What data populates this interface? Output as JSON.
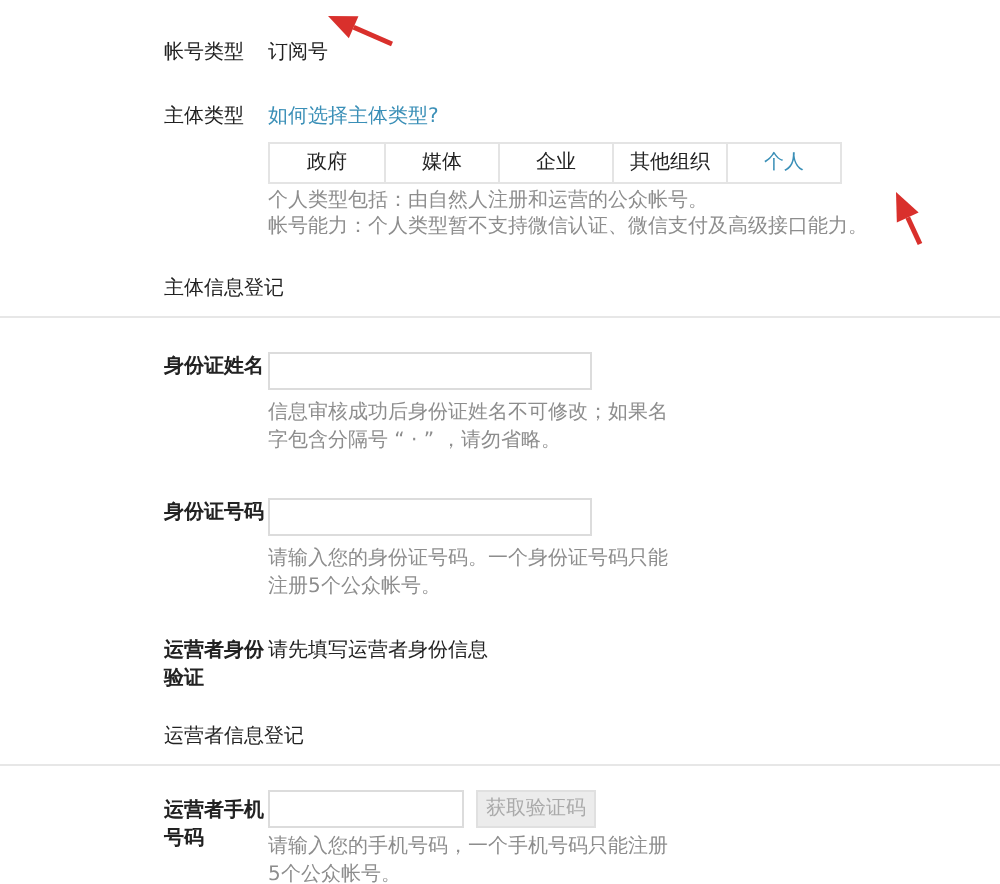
{
  "account_type": {
    "label": "帐号类型",
    "value": "订阅号"
  },
  "subject_type": {
    "label": "主体类型",
    "help_link": "如何选择主体类型?",
    "tabs": [
      {
        "label": "政府",
        "selected": false
      },
      {
        "label": "媒体",
        "selected": false
      },
      {
        "label": "企业",
        "selected": false
      },
      {
        "label": "其他组织",
        "selected": false
      },
      {
        "label": "个人",
        "selected": true
      }
    ],
    "description": [
      "个人类型包括：由自然人注册和运营的公众帐号。",
      "帐号能力：个人类型暂不支持微信认证、微信支付及高级接口能力。"
    ]
  },
  "sections": [
    {
      "title": "主体信息登记",
      "fields": [
        {
          "kind": "input",
          "label": "身份证姓名",
          "hint": "信息审核成功后身份证姓名不可修改；如果名字包含分隔号 “ · ” ，请勿省略。"
        },
        {
          "kind": "input",
          "label": "身份证号码",
          "hint": "请输入您的身份证号码。一个身份证号码只能注册5个公众帐号。"
        },
        {
          "kind": "text",
          "label": "运营者身份验证",
          "value": "请先填写运营者身份信息"
        }
      ]
    },
    {
      "title": "运营者信息登记",
      "fields": [
        {
          "kind": "input_button",
          "label": "运营者手机号码",
          "button": {
            "label": "获取验证码",
            "disabled": true
          },
          "hint": "请输入您的手机号码，一个手机号码只能注册5个公众帐号。"
        }
      ]
    }
  ]
}
